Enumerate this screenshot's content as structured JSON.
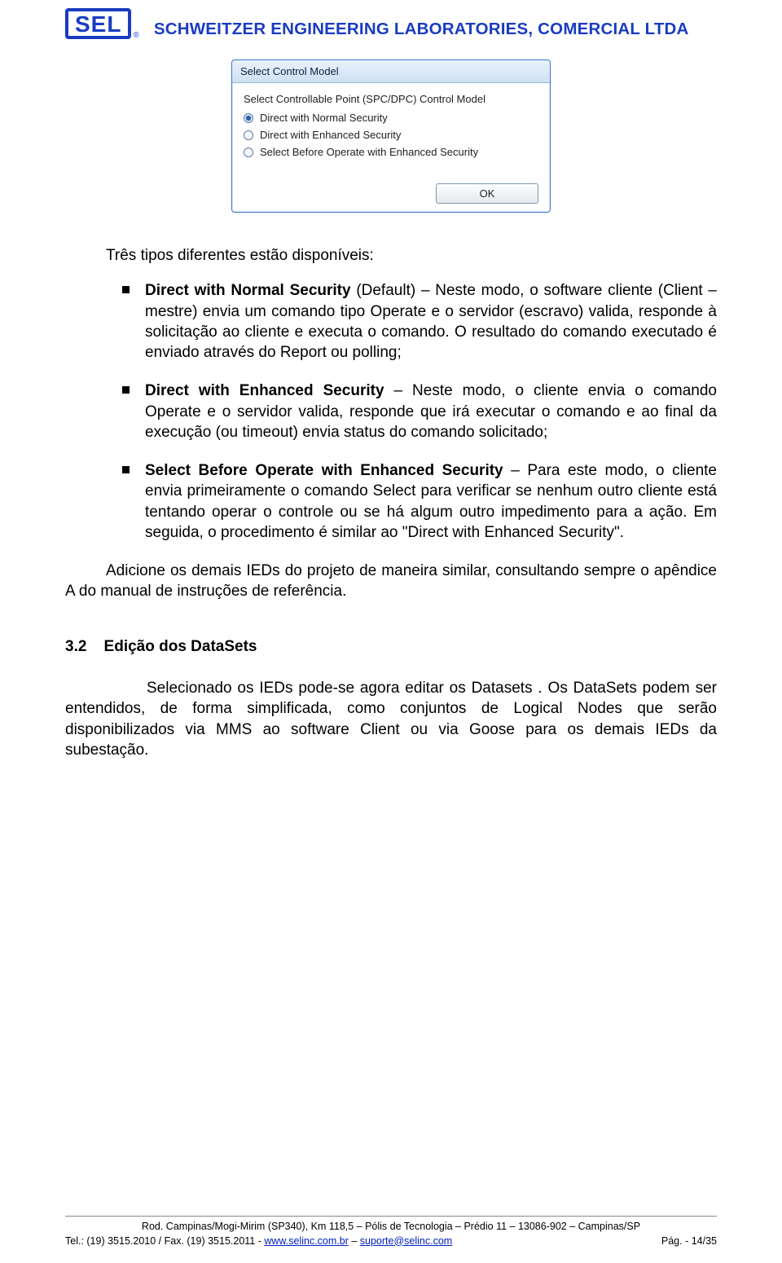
{
  "header": {
    "logo_text": "SEL",
    "logo_reg": "®",
    "company": "SCHWEITZER ENGINEERING LABORATORIES, COMERCIAL LTDA"
  },
  "dialog": {
    "title": "Select Control Model",
    "section_label": "Select Controllable Point (SPC/DPC) Control Model",
    "options": {
      "opt1": "Direct with Normal Security",
      "opt2": "Direct with Enhanced Security",
      "opt3": "Select Before Operate with Enhanced Security"
    },
    "ok_label": "OK"
  },
  "body": {
    "intro": "Três tipos diferentes estão disponíveis:",
    "item1_term": "Direct with Normal Security",
    "item1_aux": " (Default)",
    "item1_text": " – Neste modo, o software cliente (Client – mestre) envia um comando tipo Operate e o servidor (escravo) valida, responde à solicitação ao cliente e executa o comando. O resultado do comando executado é enviado através do Report ou polling;",
    "item2_term": "Direct with Enhanced Security",
    "item2_text": " – Neste modo, o cliente envia o comando Operate e o servidor valida, responde que irá executar o comando e ao final da execução (ou timeout) envia status do comando solicitado;",
    "item3_term": "Select Before Operate with Enhanced Security",
    "item3_text": " – Para este modo, o cliente envia primeiramente o comando Select para verificar se nenhum outro cliente está tentando operar o controle ou se há algum outro impedimento para a ação. Em seguida, o procedimento é similar ao \"Direct with Enhanced Security\".",
    "follow": "Adicione os demais IEDs do projeto de maneira similar, consultando sempre o apêndice A do manual de instruções de referência."
  },
  "section": {
    "number": "3.2",
    "title": "Edição dos DataSets",
    "text": "Selecionado os IEDs pode-se agora editar os Datasets . Os DataSets  podem ser entendidos, de forma simplificada, como conjuntos de Logical Nodes que serão disponibilizados via MMS ao software Client ou via Goose para os demais IEDs da subestação."
  },
  "footer": {
    "line1": "Rod. Campinas/Mogi-Mirim (SP340), Km 118,5 – Pólis de Tecnologia – Prédio 11 – 13086-902 – Campinas/SP",
    "tel_fax": "Tel.: (19) 3515.2010 / Fax. (19) 3515.2011 - ",
    "link1": "www.selinc.com.br",
    "sep": " – ",
    "link2": "suporte@selinc.com",
    "page": "Pág. - 14/35"
  }
}
